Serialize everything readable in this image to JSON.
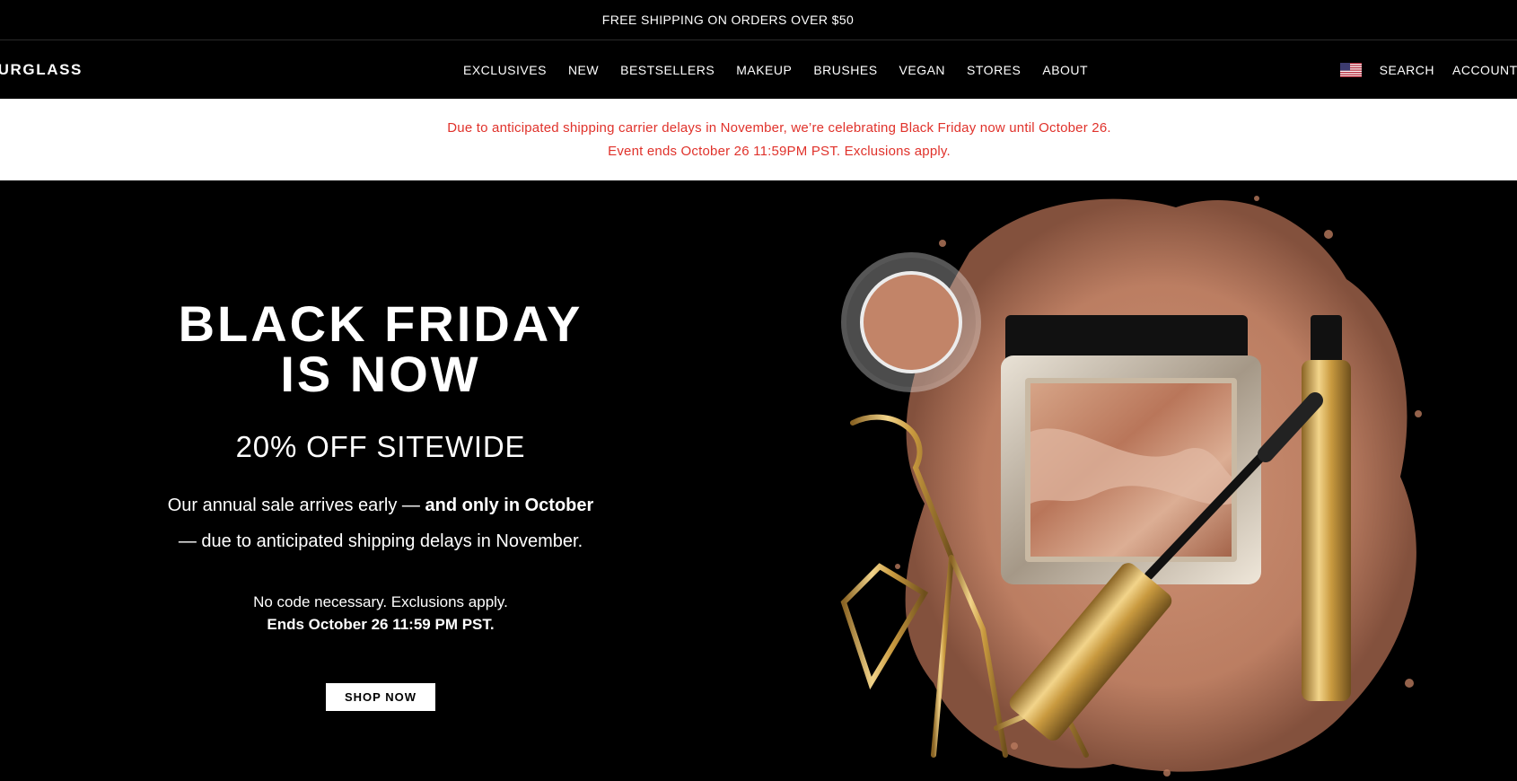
{
  "announcement": "FREE SHIPPING ON ORDERS OVER $50",
  "brand": "HOURGLASS",
  "nav_items": [
    "EXCLUSIVES",
    "NEW",
    "BESTSELLERS",
    "MAKEUP",
    "BRUSHES",
    "VEGAN",
    "STORES",
    "ABOUT"
  ],
  "nav_right": {
    "search": "SEARCH",
    "account": "ACCOUNT"
  },
  "promo": {
    "line1": "Due to anticipated shipping carrier delays in November, we’re celebrating Black Friday now until October 26.",
    "line2": "Event ends October 26 11:59PM PST. Exclusions apply."
  },
  "hero": {
    "headline_1": "BLACK FRIDAY",
    "headline_2": "IS NOW",
    "subheadline": "20% OFF SITEWIDE",
    "body_1a": "Our annual sale arrives early — ",
    "body_1b": "and only in October",
    "body_2": "— due to anticipated shipping delays in November.",
    "note_1": "No code necessary. Exclusions apply.",
    "note_2": "Ends October 26 11:59 PM PST.",
    "cta": "SHOP NOW"
  },
  "colors": {
    "background": "#000000",
    "promo_text": "#e0322b",
    "powder": "#c98a6c",
    "gold": "#d9a94c"
  }
}
